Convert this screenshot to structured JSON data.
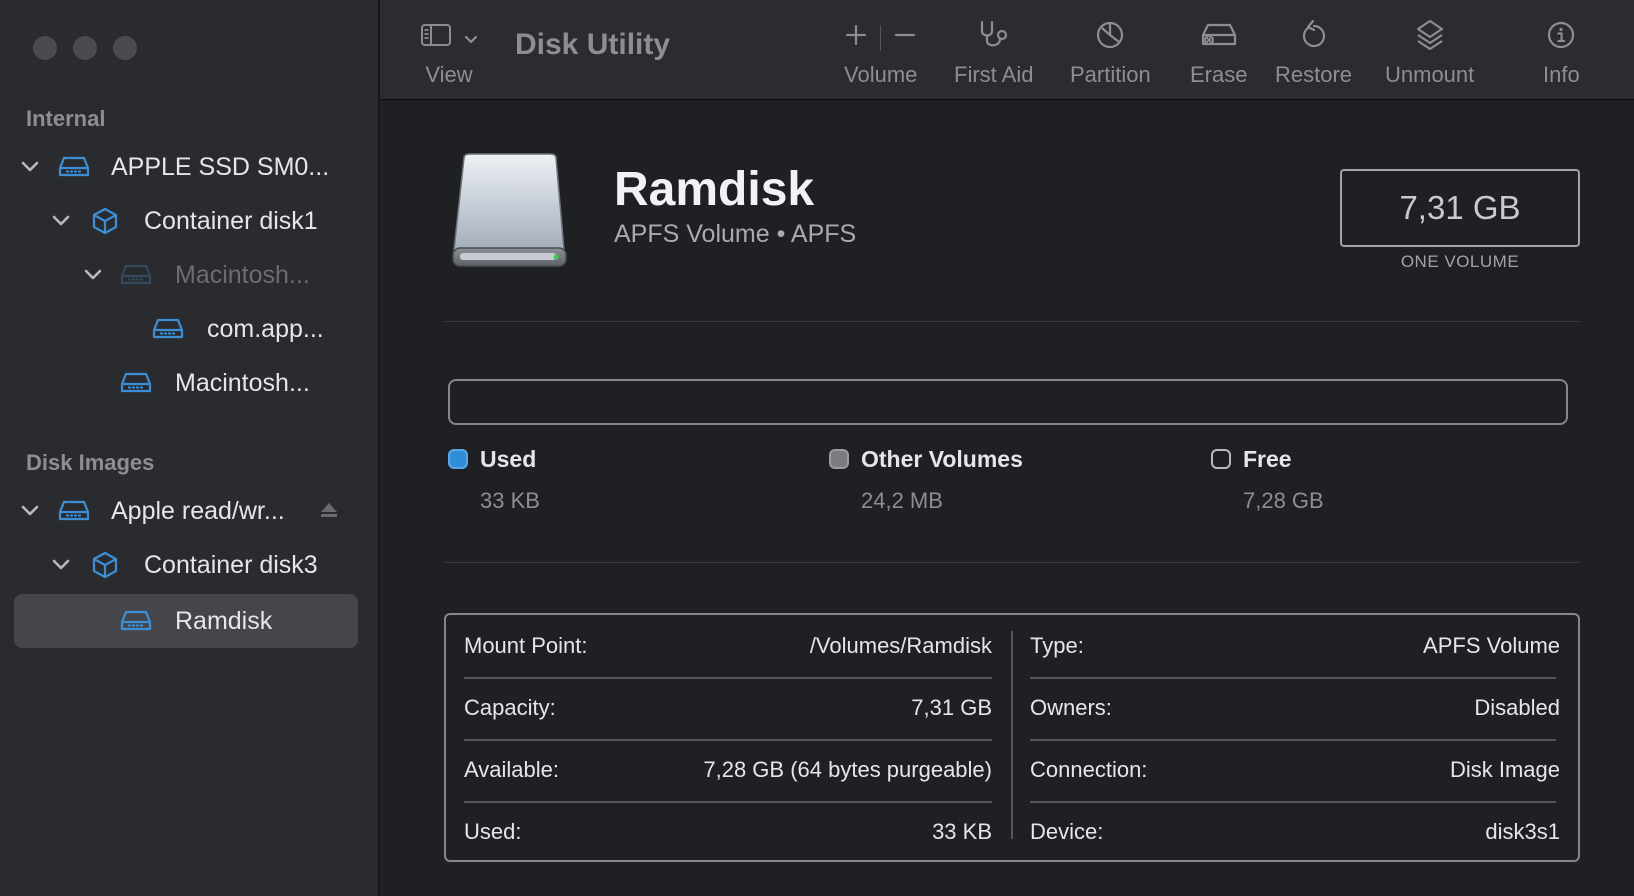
{
  "sidebar": {
    "sections": {
      "internal": "Internal",
      "disk_images": "Disk Images"
    },
    "items": [
      {
        "label": "APPLE SSD SM0..."
      },
      {
        "label": "Container disk1"
      },
      {
        "label": "Macintosh..."
      },
      {
        "label": "com.app..."
      },
      {
        "label": "Macintosh..."
      },
      {
        "label": "Apple read/wr..."
      },
      {
        "label": "Container disk3"
      },
      {
        "label": "Ramdisk"
      }
    ],
    "selected_index": 7
  },
  "toolbar": {
    "title": "Disk Utility",
    "view": "View",
    "volume": "Volume",
    "first_aid": "First Aid",
    "partition": "Partition",
    "erase": "Erase",
    "restore": "Restore",
    "unmount": "Unmount",
    "info": "Info"
  },
  "volume": {
    "name": "Ramdisk",
    "subtitle": "APFS Volume • APFS",
    "capacity": "7,31 GB",
    "capacity_caption": "ONE VOLUME"
  },
  "usage": {
    "used_label": "Used",
    "used_value": "33 KB",
    "used_color": "#2f8ed8",
    "other_label": "Other Volumes",
    "other_value": "24,2 MB",
    "other_color": "#7b7c80",
    "free_label": "Free",
    "free_value": "7,28 GB"
  },
  "info": {
    "left": [
      {
        "key": "Mount Point:",
        "value": "/Volumes/Ramdisk"
      },
      {
        "key": "Capacity:",
        "value": "7,31 GB"
      },
      {
        "key": "Available:",
        "value": "7,28 GB (64 bytes purgeable)"
      },
      {
        "key": "Used:",
        "value": "33 KB"
      }
    ],
    "right": [
      {
        "key": "Type:",
        "value": "APFS Volume"
      },
      {
        "key": "Owners:",
        "value": "Disabled"
      },
      {
        "key": "Connection:",
        "value": "Disk Image"
      },
      {
        "key": "Device:",
        "value": "disk3s1"
      }
    ]
  },
  "colors": {
    "accent": "#3c8fd6",
    "sidebar_bg": "#2a2b2f",
    "main_bg": "#1f2023"
  }
}
